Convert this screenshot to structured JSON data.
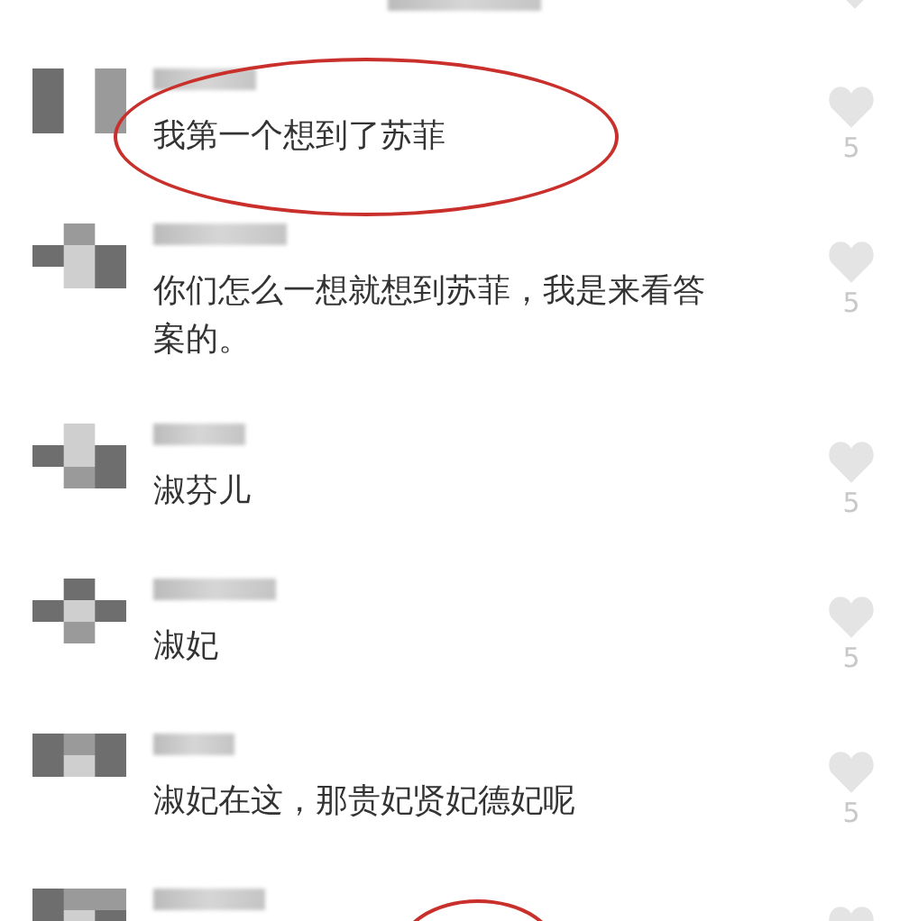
{
  "comments": [
    {
      "kind": "cut_top"
    },
    {
      "kind": "comment",
      "text": "我第一个想到了苏菲",
      "likes": "5",
      "highlighted": true
    },
    {
      "kind": "comment",
      "text": "你们怎么一想就想到苏菲，我是来看答案的。",
      "likes": "5",
      "highlighted": false
    },
    {
      "kind": "comment",
      "text": "淑芬儿",
      "likes": "5",
      "highlighted": false
    },
    {
      "kind": "comment",
      "text": "淑妃",
      "likes": "5",
      "highlighted": false
    },
    {
      "kind": "comment",
      "text": "淑妃在这，那贵妃贤妃德妃呢",
      "likes": "5",
      "highlighted": false
    },
    {
      "kind": "comment",
      "highlighted": true
    }
  ]
}
